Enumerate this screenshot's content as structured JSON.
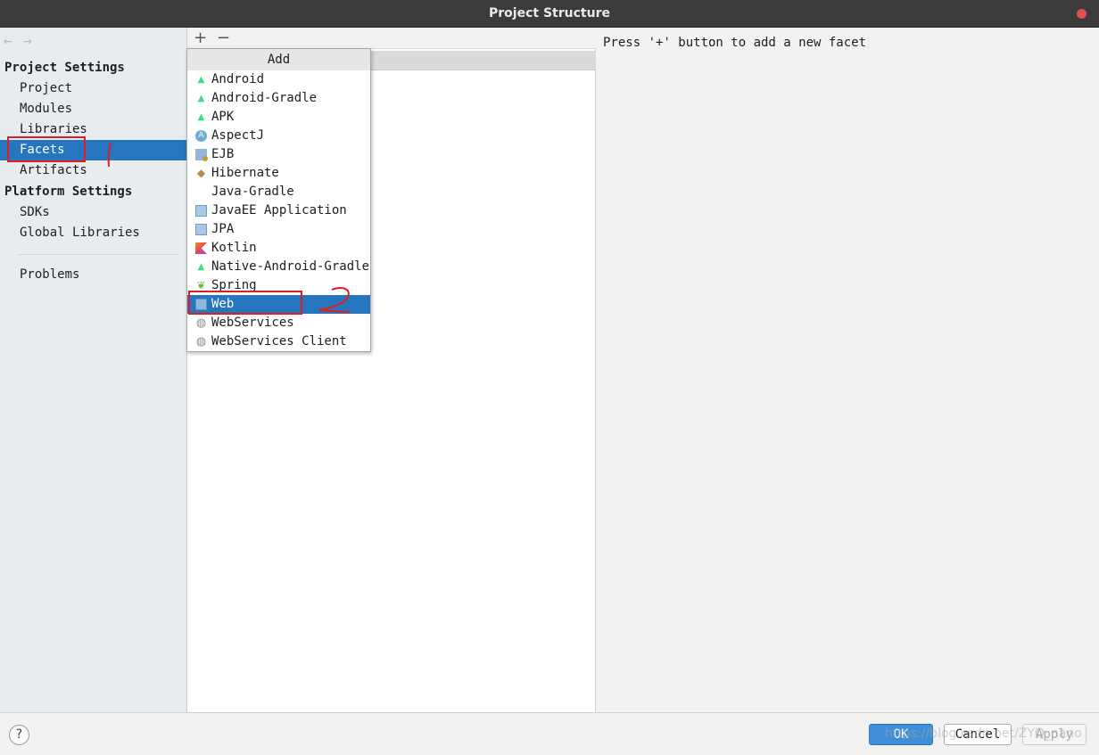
{
  "window": {
    "title": "Project Structure"
  },
  "nav": {
    "back": "←",
    "forward": "→"
  },
  "sidebar": {
    "project_settings_header": "Project Settings",
    "project_items": [
      "Project",
      "Modules",
      "Libraries",
      "Facets",
      "Artifacts"
    ],
    "platform_settings_header": "Platform Settings",
    "platform_items": [
      "SDKs",
      "Global Libraries"
    ],
    "problems": "Problems",
    "selected": "Facets"
  },
  "toolbar": {
    "add": "+",
    "remove": "−"
  },
  "popup": {
    "title": "Add",
    "items": [
      {
        "label": "Android",
        "icon": "android-icon"
      },
      {
        "label": "Android-Gradle",
        "icon": "android-icon"
      },
      {
        "label": "APK",
        "icon": "android-icon"
      },
      {
        "label": "AspectJ",
        "icon": "aspectj-icon"
      },
      {
        "label": "EJB",
        "icon": "ejb-icon"
      },
      {
        "label": "Hibernate",
        "icon": "hibernate-icon"
      },
      {
        "label": "Java-Gradle",
        "icon": ""
      },
      {
        "label": "JavaEE Application",
        "icon": "javaee-icon"
      },
      {
        "label": "JPA",
        "icon": "jpa-icon"
      },
      {
        "label": "Kotlin",
        "icon": "kotlin-icon"
      },
      {
        "label": "Native-Android-Gradle",
        "icon": "android-icon"
      },
      {
        "label": "Spring",
        "icon": "spring-icon"
      },
      {
        "label": "Web",
        "icon": "web-icon"
      },
      {
        "label": "WebServices",
        "icon": "globe-icon"
      },
      {
        "label": "WebServices Client",
        "icon": "globe-icon"
      }
    ],
    "selected": "Web"
  },
  "right_panel": {
    "hint": "Press '+' button to add a new facet"
  },
  "footer": {
    "help": "?",
    "ok": "OK",
    "cancel": "Cancel",
    "apply": "Apply",
    "watermark": "https://blog.csdn.net/ZYQ_nano"
  },
  "annotations": {
    "mark1": "1",
    "mark2": "2",
    "color": "#e11d1d"
  },
  "colors": {
    "selection": "#2675bf",
    "titlebar": "#3b3b3b",
    "close": "#e05252"
  }
}
